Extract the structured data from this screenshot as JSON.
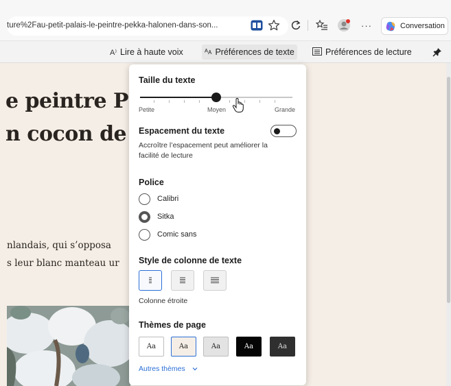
{
  "browser": {
    "url": "ture%2Fau-petit-palais-le-peintre-pekka-halonen-dans-son...",
    "conversation_label": "Conversation"
  },
  "reader_toolbar": {
    "read_aloud_label": "Lire à haute voix",
    "read_aloud_glyph": "A⁾",
    "text_prefs_label": "Préférences de texte",
    "text_prefs_glyph": "ᴬᴀ",
    "reading_prefs_label": "Préférences de lecture"
  },
  "article": {
    "headline_line1": "e peintre P",
    "headline_line2": "n cocon de",
    "para_line1": "nlandais, qui s’opposa",
    "para_line2": "s leur blanc manteau ur"
  },
  "panel": {
    "text_size": {
      "title": "Taille du texte",
      "label_small": "Petite",
      "label_medium": "Moyen",
      "label_large": "Grande",
      "value_fraction": 0.5
    },
    "text_spacing": {
      "title": "Espacement du texte",
      "description": "Accroître l’espacement peut améliorer la facilité de lecture",
      "enabled": false
    },
    "font": {
      "title": "Police",
      "options": [
        "Calibri",
        "Sitka",
        "Comic sans"
      ],
      "selected": "Sitka"
    },
    "column_style": {
      "title": "Style de colonne de texte",
      "selected_label": "Colonne étroite",
      "options_glyphs": [
        "≡",
        "≡",
        "≣"
      ]
    },
    "page_themes": {
      "title": "Thèmes de page",
      "themes": [
        "Aa",
        "Aa",
        "Aa",
        "Aa",
        "Aa"
      ],
      "more_label": "Autres thèmes",
      "colors": {
        "theme1_bg": "#ffffff",
        "theme1_fg": "#222222",
        "theme2_bg": "#f5eee6",
        "theme2_fg": "#222222",
        "theme3_bg": "#e3e3e3",
        "theme3_fg": "#222222",
        "theme4_bg": "#050505",
        "theme4_fg": "#ffffff",
        "theme5_bg": "#2f2f2f",
        "theme5_fg": "#dddddd"
      }
    }
  },
  "colors": {
    "accent": "#2b6fd6",
    "article_bg": "#f5eee6"
  }
}
